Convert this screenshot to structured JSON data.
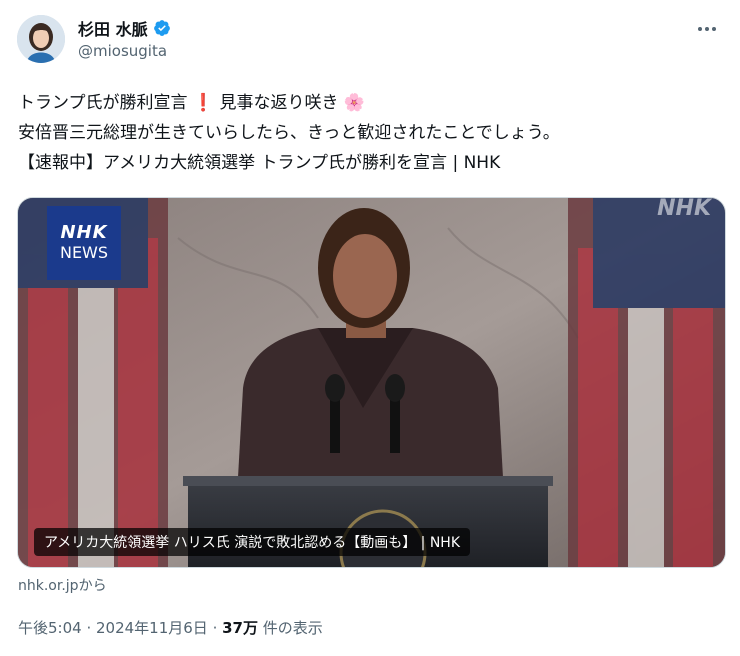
{
  "author": {
    "name": "杉田 水脈",
    "handle": "@miosugita"
  },
  "post": {
    "line1_text": "トランプ氏が勝利宣言",
    "line1_emoji_a": "❗",
    "line1_text_b": "見事な返り咲き",
    "line1_emoji_b": "🌸",
    "line2": "安倍晋三元総理が生きていらしたら、きっと歓迎されたことでしょう。",
    "line3": "【速報中】アメリカ大統領選挙 トランプ氏が勝利を宣言 | NHK"
  },
  "card": {
    "logo_line1": "NHK",
    "logo_line2": "NEWS",
    "watermark": "NHK",
    "caption": "アメリカ大統領選挙 ハリス氏 演説で敗北認める【動画も】 | NHK",
    "source": "nhk.or.jpから"
  },
  "meta": {
    "time": "午後5:04",
    "sep1": " · ",
    "date": "2024年11月6日",
    "sep2": " · ",
    "views": "37万",
    "views_suffix": " 件の表示"
  },
  "icons": {
    "verified": "verified-badge-icon",
    "more": "more-options-icon"
  },
  "colors": {
    "verified": "#1d9bf0",
    "nhk_blue": "#1b3a8c",
    "muted": "#536471",
    "exclamation": "#e0245e"
  }
}
